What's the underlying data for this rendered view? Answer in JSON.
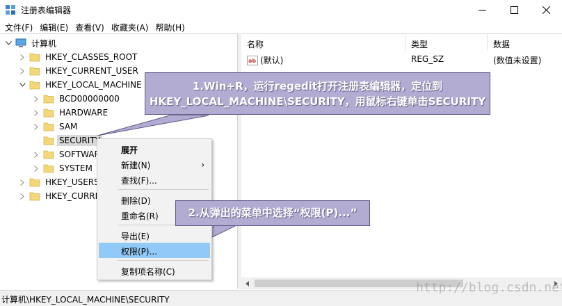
{
  "window": {
    "title": "注册表编辑器",
    "icons": {
      "app": "regedit-icon",
      "minimize": "minimize-icon",
      "maximize": "maximize-icon",
      "close": "close-icon"
    }
  },
  "menubar": {
    "items": [
      "文件(F)",
      "编辑(E)",
      "查看(V)",
      "收藏夹(A)",
      "帮助(H)"
    ]
  },
  "tree": {
    "root": "计算机",
    "hives": {
      "classes_root": "HKEY_CLASSES_ROOT",
      "current_user": "HKEY_CURRENT_USER",
      "local_machine": "HKEY_LOCAL_MACHINE",
      "users": "HKEY_USERS",
      "current_config": "HKEY_CURRE"
    },
    "local_machine_children": [
      "BCD00000000",
      "HARDWARE",
      "SAM",
      "SECURITY",
      "SOFTWAR",
      "SYSTEM"
    ],
    "selected": "SECURITY"
  },
  "list": {
    "columns": {
      "name": "名称",
      "type": "类型",
      "data": "数据"
    },
    "rows": [
      {
        "name": "(默认)",
        "type": "REG_SZ",
        "data": "(数值未设置)"
      }
    ]
  },
  "context_menu": {
    "items": {
      "expand": "展开",
      "new": "新建(N)",
      "find": "查找(F)...",
      "delete": "删除(D)",
      "rename": "重命名(R)",
      "export": "导出(E)",
      "permissions": "权限(P)...",
      "copy_key_name": "复制项名称(C)"
    },
    "new_submenu_arrow": "›",
    "highlighted": "权限(P)..."
  },
  "callouts": {
    "step1_line1": "1.Win+R，运行regedit打开注册表编辑器，定位到",
    "step1_line2": "HKEY_LOCAL_MACHINE\\SECURITY，用鼠标右键单击SECURITY",
    "step2": "2.从弹出的菜单中选择“权限(P)...”"
  },
  "statusbar": {
    "path": "计算机\\HKEY_LOCAL_MACHINE\\SECURITY"
  },
  "watermark": "http://blog.csdn.net/",
  "colors": {
    "folder": "#f3d77a",
    "highlight": "#91c9f7",
    "callout_fill": "#b3acd2",
    "callout_border": "#5e5786",
    "selected_bg": "#d9d9d9"
  }
}
